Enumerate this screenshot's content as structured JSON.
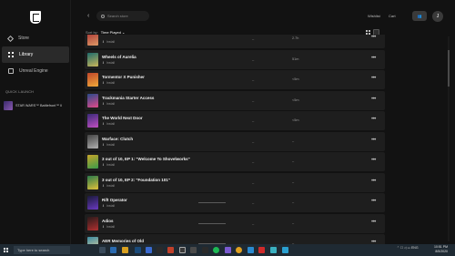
{
  "header": {
    "back_glyph": "‹",
    "search_placeholder": "Search store",
    "wishlist": "Wishlist",
    "cart": "Cart",
    "friends_count": "0",
    "avatar_initial": "J"
  },
  "sidebar": {
    "items": [
      {
        "label": "Store",
        "icon": "tag-icon"
      },
      {
        "label": "Library",
        "icon": "grid-icon"
      },
      {
        "label": "Unreal Engine",
        "icon": "engine-icon"
      }
    ],
    "quick_launch_label": "QUICK LAUNCH",
    "quick_launch_item": "STAR WARS™ Battlefront™ II"
  },
  "sortbar": {
    "label": "Sort by:",
    "value": "Time Played ⌄"
  },
  "games": [
    {
      "title": "",
      "status": "Install",
      "played": "2.7h",
      "colors": [
        "#a33",
        "#d96"
      ]
    },
    {
      "title": "Wheels of Aurelia",
      "status": "Install",
      "played": "51m",
      "colors": [
        "#1d6b6b",
        "#c9b55a"
      ]
    },
    {
      "title": "Tormentor X Punisher",
      "status": "Install",
      "played": "<5m",
      "colors": [
        "#c0472a",
        "#f0a93a"
      ]
    },
    {
      "title": "Trackmania Starter Access",
      "status": "Install",
      "played": "<5m",
      "colors": [
        "#2a4a8a",
        "#e04a8a"
      ]
    },
    {
      "title": "The World Next Door",
      "status": "Install",
      "played": "<5m",
      "colors": [
        "#3a2a7a",
        "#c050c0"
      ]
    },
    {
      "title": "Warface: Clutch",
      "status": "Install",
      "played": "–",
      "colors": [
        "#444",
        "#b0b0b0"
      ]
    },
    {
      "title": "3 out of 10, EP 1: \"Welcome To Shovelworks\"",
      "status": "Install",
      "played": "–",
      "colors": [
        "#c7a52a",
        "#3a9a4a"
      ]
    },
    {
      "title": "3 out of 10, EP 2: \"Foundation 101\"",
      "status": "Install",
      "played": "–",
      "colors": [
        "#2a7a4a",
        "#e0c03a"
      ]
    },
    {
      "title": "Rift Operator",
      "status": "Install",
      "played": "–",
      "colors": [
        "#1a1a3a",
        "#6a3ac0"
      ]
    },
    {
      "title": "Adios",
      "status": "Install",
      "played": "–",
      "colors": [
        "#2a1a1a",
        "#b03030"
      ]
    },
    {
      "title": "AER Memories of Old",
      "status": "Install",
      "played": "–",
      "colors": [
        "#3a8aa0",
        "#e0d0a0"
      ]
    }
  ],
  "taskbar": {
    "search_placeholder": "Type here to search",
    "time": "10:51 PM",
    "date": "8/5/2020",
    "lang": "ENG"
  }
}
